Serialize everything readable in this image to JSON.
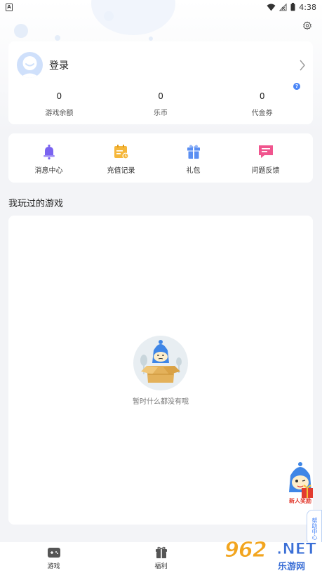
{
  "status_bar": {
    "app_indicator": "A",
    "time": "4:38"
  },
  "profile": {
    "login_label": "登录",
    "stats": [
      {
        "value": "0",
        "label": "游戏余额"
      },
      {
        "value": "0",
        "label": "乐币"
      },
      {
        "value": "0",
        "label": "代金券"
      }
    ],
    "help_mark": "?"
  },
  "shortcuts": [
    {
      "label": "消息中心",
      "icon": "bell-icon",
      "color": "#7a63f0"
    },
    {
      "label": "充值记录",
      "icon": "calendar-icon",
      "color": "#f5b73b"
    },
    {
      "label": "礼包",
      "icon": "gift-icon",
      "color": "#5b8ff2"
    },
    {
      "label": "问题反馈",
      "icon": "feedback-icon",
      "color": "#f0558e"
    }
  ],
  "games_section": {
    "title": "我玩过的游戏",
    "empty_text": "暂时什么都没有哦"
  },
  "floating": {
    "mascot_label": "新人奖励",
    "help_tab": "帮助中心"
  },
  "bottom_nav": [
    {
      "label": "游戏",
      "icon": "gamepad-icon"
    },
    {
      "label": "福利",
      "icon": "gift-icon"
    }
  ],
  "watermark": {
    "brand": "962",
    "domain": ".NET",
    "subtitle": "乐游网"
  },
  "colors": {
    "accent_blue": "#4a86f7",
    "background": "#f3f4f7"
  }
}
